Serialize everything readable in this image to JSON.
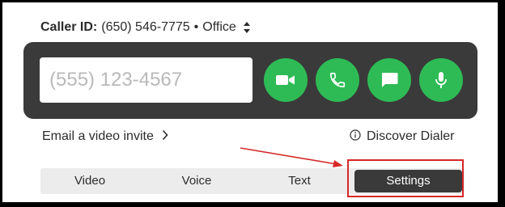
{
  "caller_id": {
    "label": "Caller ID:",
    "number": "(650) 546-7775",
    "separator": "•",
    "line_name": "Office",
    "selector_icon": "up-down-chevron-icon"
  },
  "dialer": {
    "number_placeholder": "(555) 123-4567",
    "number_value": "",
    "buttons": [
      {
        "name": "video-call",
        "icon": "video-camera-icon"
      },
      {
        "name": "voice-call",
        "icon": "phone-icon"
      },
      {
        "name": "text-message",
        "icon": "message-bubble-icon"
      },
      {
        "name": "voice-record",
        "icon": "microphone-icon"
      }
    ]
  },
  "links": {
    "email_invite": "Email a video invite",
    "email_invite_icon": "chevron-right-icon",
    "discover": "Discover Dialer",
    "discover_icon": "info-icon"
  },
  "tabs": {
    "items": [
      "Video",
      "Voice",
      "Text",
      "Settings"
    ],
    "active": "Settings"
  },
  "annotation": {
    "highlight_color": "#d62828",
    "arrow_target": "Settings"
  },
  "colors": {
    "panel": "#3a3a3a",
    "accent_green": "#2ebb55",
    "tab_bar": "#ececec",
    "active_tab": "#3a3a3a"
  }
}
